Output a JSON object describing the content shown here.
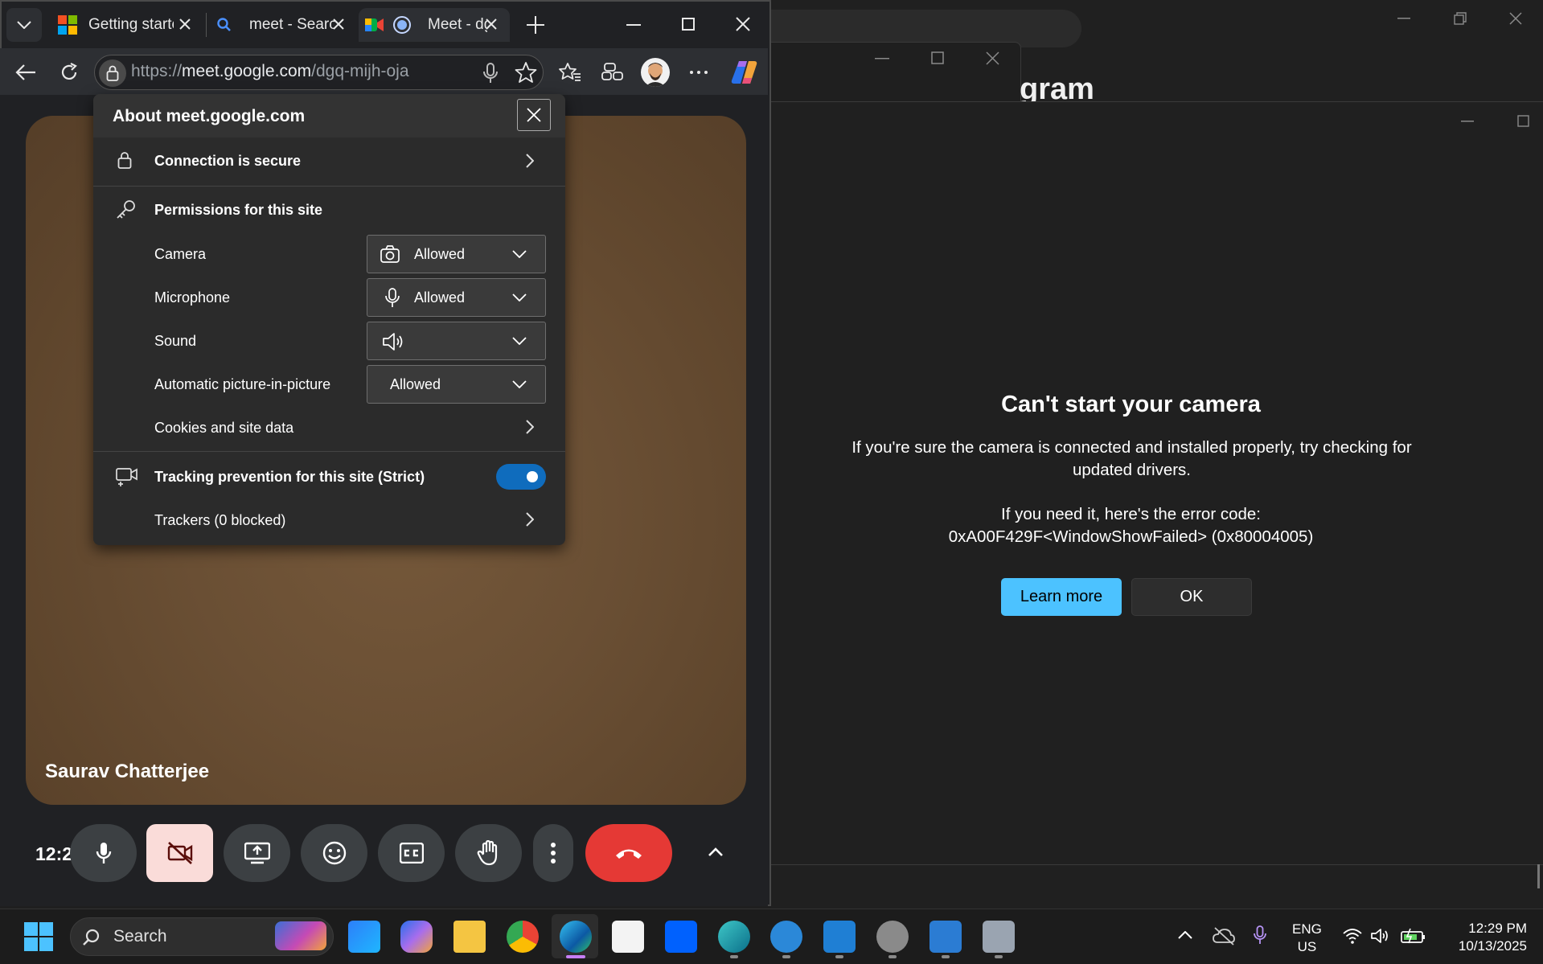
{
  "browser": {
    "tabs": [
      {
        "title": "Getting started"
      },
      {
        "title": "meet - Search"
      },
      {
        "title": "Meet - dgq-mijh-oja"
      }
    ],
    "url": {
      "scheme": "https://",
      "host": "meet.google.com",
      "path": "/dgq-mijh-oja"
    }
  },
  "site_info": {
    "title": "About meet.google.com",
    "connection": "Connection is secure",
    "permissions_heading": "Permissions for this site",
    "permissions": [
      {
        "label": "Camera",
        "value": "Allowed",
        "icon": "camera-icon"
      },
      {
        "label": "Microphone",
        "value": "Allowed",
        "icon": "microphone-icon"
      },
      {
        "label": "Sound",
        "value": "",
        "icon": "speaker-icon"
      },
      {
        "label": "Automatic picture-in-picture",
        "value": "Allowed",
        "icon": ""
      }
    ],
    "cookies": "Cookies and site data",
    "tracking_label": "Tracking prevention for this site (Strict)",
    "tracking_enabled": true,
    "trackers": "Trackers (0 blocked)"
  },
  "meet": {
    "participant_name": "Saurav Chatterjee",
    "clock": "12:2"
  },
  "camera_app": {
    "partial_title": "gram",
    "error_title": "Can't start your camera",
    "error_body": "If you're sure the camera is connected and installed properly, try checking for updated drivers.",
    "error_code_label": "If you need it, here's the error code:",
    "error_code": "0xA00F429F<WindowShowFailed> (0x80004005)",
    "learn_more": "Learn more",
    "ok": "OK"
  },
  "taskbar": {
    "search_placeholder": "Search",
    "lang_line1": "ENG",
    "lang_line2": "US",
    "time": "12:29 PM",
    "date": "10/13/2025"
  },
  "colors": {
    "accent_blue": "#4cc2ff",
    "toggle_blue": "#0f6cbd",
    "end_call_red": "#e53935",
    "camera_off_bg": "#fadcd9"
  }
}
